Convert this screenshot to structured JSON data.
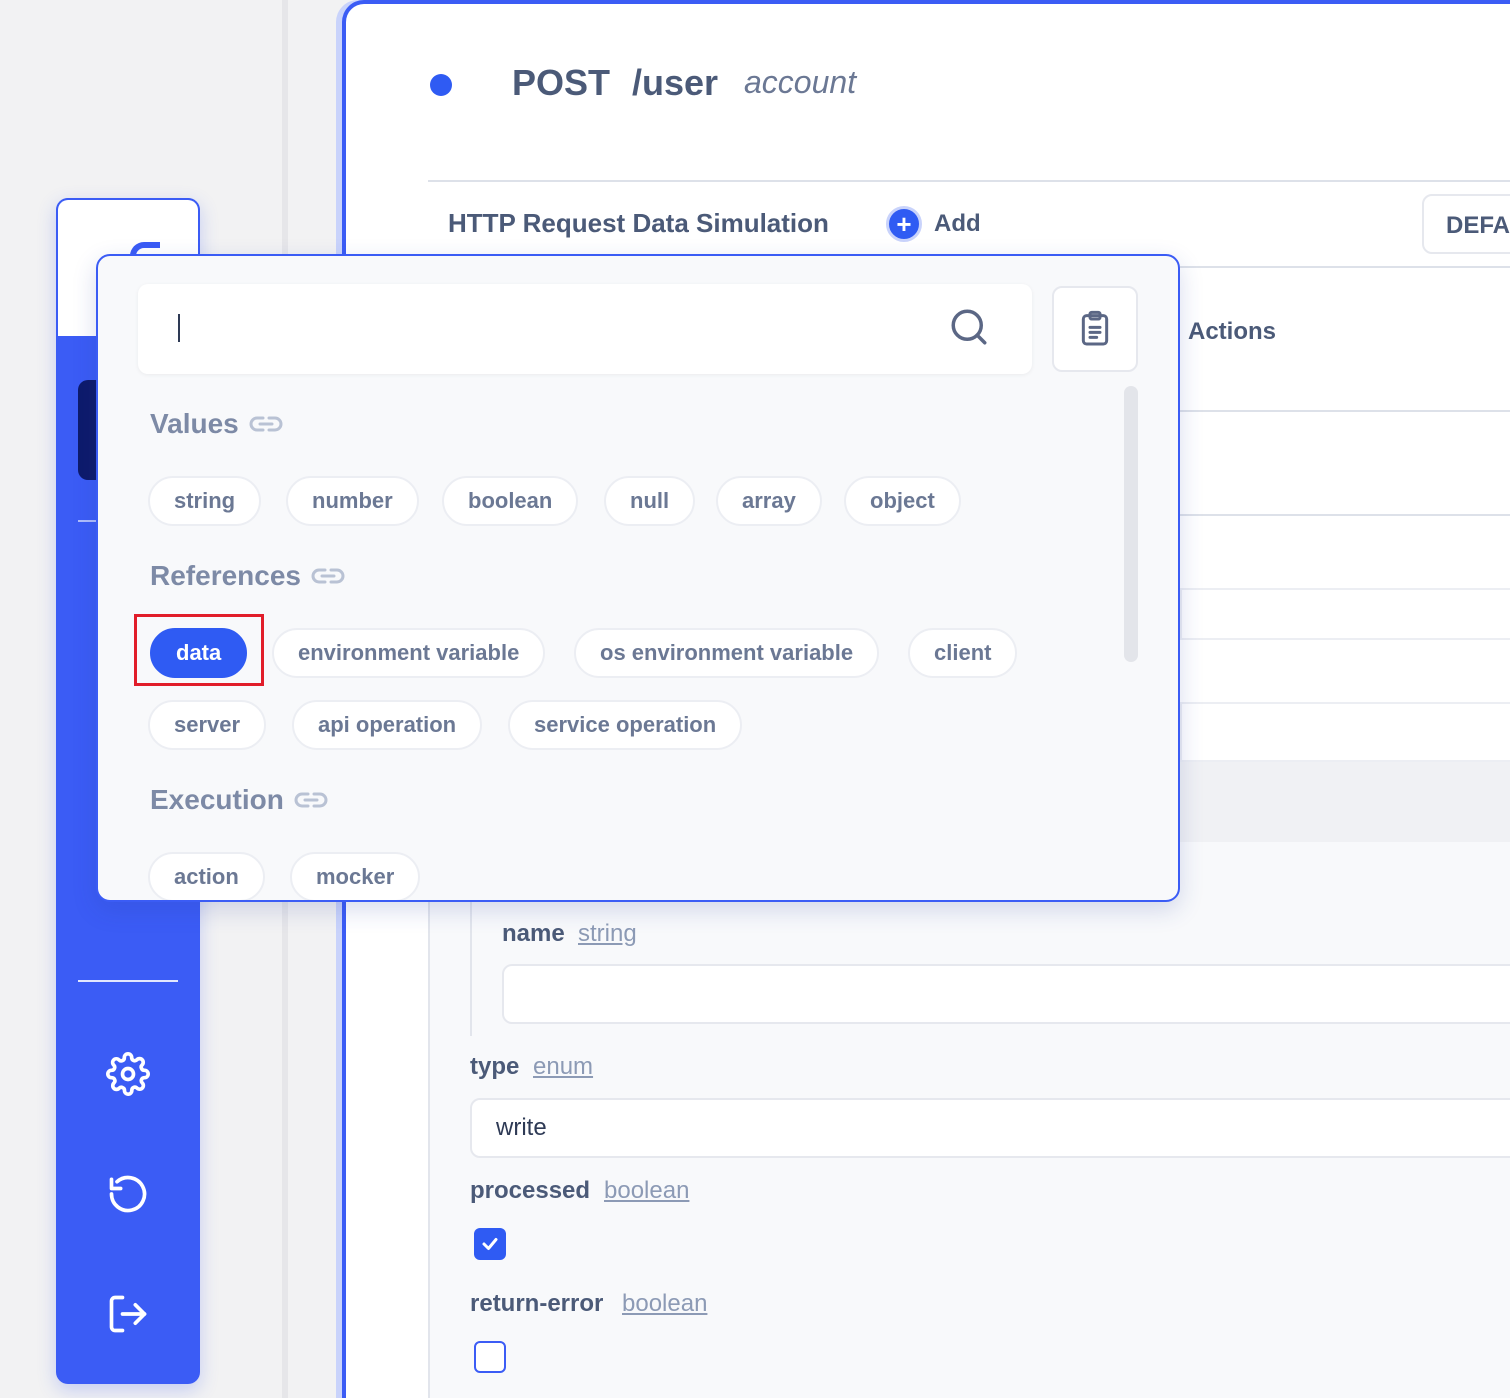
{
  "endpoint": {
    "method": "POST",
    "path": "/user",
    "tag": "account"
  },
  "simulation": {
    "title": "HTTP Request Data Simulation",
    "add_label": "Add",
    "default_label": "DEFAU"
  },
  "right_panel": {
    "actions_label": "Actions"
  },
  "popover": {
    "search": {
      "value": "",
      "placeholder": ""
    },
    "sections": {
      "values": {
        "title": "Values",
        "chips": [
          "string",
          "number",
          "boolean",
          "null",
          "array",
          "object"
        ]
      },
      "references": {
        "title": "References",
        "chips": [
          "data",
          "environment variable",
          "os environment variable",
          "client",
          "server",
          "api operation",
          "service operation"
        ],
        "active": "data"
      },
      "execution": {
        "title": "Execution",
        "chips": [
          "action",
          "mocker"
        ]
      }
    }
  },
  "form": {
    "fields": [
      {
        "label": "name",
        "type": "string",
        "value": ""
      },
      {
        "label": "type",
        "type": "enum",
        "value": "write"
      },
      {
        "label": "processed",
        "type": "boolean",
        "checked": true
      },
      {
        "label": "return-error",
        "type": "boolean",
        "checked": false
      }
    ]
  },
  "sidebar": {
    "icons": [
      "settings-icon",
      "history-icon",
      "logout-icon"
    ]
  },
  "colors": {
    "accent": "#3b5cf5",
    "active_chip": "#2f5bf3",
    "highlight": "#e11d2a"
  }
}
